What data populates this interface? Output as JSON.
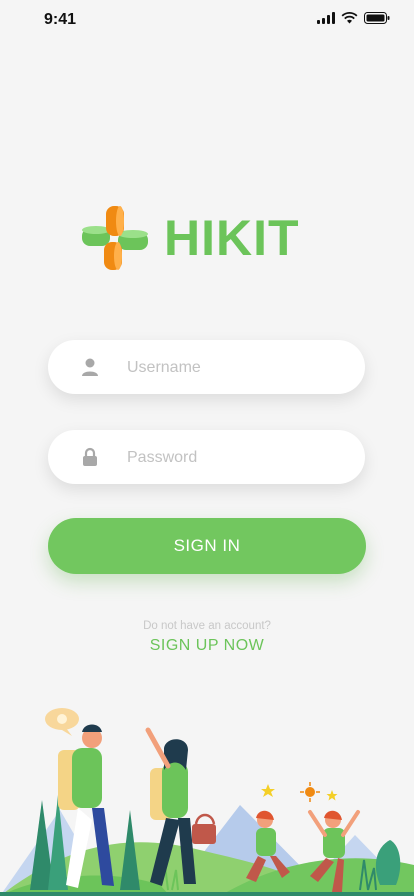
{
  "status_bar": {
    "time": "9:41",
    "icons": [
      "signal-icon",
      "wifi-icon",
      "battery-icon"
    ]
  },
  "brand": {
    "name": "HIKIT",
    "color": "#6cc45a",
    "accent": "#f08a12"
  },
  "login": {
    "username_placeholder": "Username",
    "password_placeholder": "Password",
    "signin_label": "SIGN IN",
    "no_account_text": "Do not have an account?",
    "signup_label": "SIGN UP NOW"
  },
  "colors": {
    "primary": "#72c75f",
    "background": "#f5f5f5"
  }
}
